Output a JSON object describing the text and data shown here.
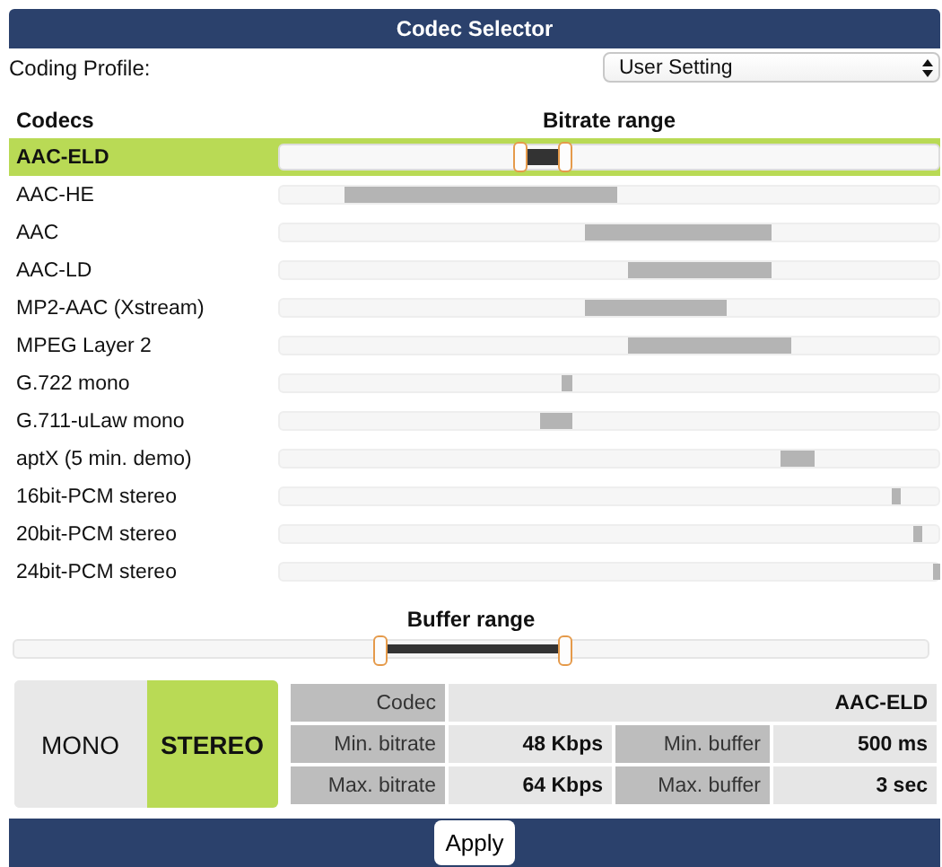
{
  "title": "Codec Selector",
  "profile": {
    "label": "Coding Profile:",
    "value": "User Setting"
  },
  "codec_header": "Codecs",
  "bitrate_header": "Bitrate range",
  "codecs": [
    {
      "name": "AAC-ELD",
      "selected": true,
      "start": {
        "level": 0.366
      },
      "end": {
        "level": 0.434
      }
    },
    {
      "name": "AAC-HE",
      "selected": false,
      "start": {
        "level": 0.1
      },
      "end": {
        "level": 0.51
      }
    },
    {
      "name": "AAC",
      "selected": false,
      "start": {
        "level": 0.466
      },
      "end": {
        "level": 0.743
      }
    },
    {
      "name": "AAC-LD",
      "selected": false,
      "start": {
        "level": 0.531
      },
      "end": {
        "level": 0.743
      }
    },
    {
      "name": "MP2-AAC (Xstream)",
      "selected": false,
      "start": {
        "level": 0.466
      },
      "end": {
        "level": 0.675
      }
    },
    {
      "name": "MPEG Layer 2",
      "selected": false,
      "start": {
        "level": 0.531
      },
      "end": {
        "level": 0.775
      }
    },
    {
      "name": "G.722 mono",
      "selected": false,
      "start": {
        "level": 0.431
      },
      "end": {
        "level": 0.442
      }
    },
    {
      "name": "G.711-uLaw mono",
      "selected": false,
      "start": {
        "level": 0.398
      },
      "end": {
        "level": 0.442
      }
    },
    {
      "name": "aptX (5 min. demo)",
      "selected": false,
      "start": {
        "level": 0.764
      },
      "end": {
        "level": 0.81
      }
    },
    {
      "name": "16bit-PCM stereo",
      "selected": false,
      "start": {
        "level": 0.932
      },
      "end": {
        "level": 0.94
      }
    },
    {
      "name": "20bit-PCM stereo",
      "selected": false,
      "start": {
        "level": 0.965
      },
      "end": {
        "level": 0.973
      }
    },
    {
      "name": "24bit-PCM stereo",
      "selected": false,
      "start": {
        "level": 0.995
      },
      "end": {
        "level": 1.0
      }
    }
  ],
  "buffer": {
    "label": "Buffer range",
    "start": {
      "level": 0.4
    },
    "end": {
      "level": 0.603
    }
  },
  "modes": [
    {
      "label": "MONO",
      "selected": false
    },
    {
      "label": "STEREO",
      "selected": true
    }
  ],
  "info": [
    {
      "label": "Codec",
      "value": "AAC-ELD"
    },
    {
      "label": "Min. bitrate",
      "value": "48 Kbps"
    },
    {
      "label": "Min. buffer",
      "value": "500 ms"
    },
    {
      "label": "Max. bitrate",
      "value": "64 Kbps"
    },
    {
      "label": "Max. buffer",
      "value": "3 sec"
    }
  ],
  "apply": "Apply"
}
